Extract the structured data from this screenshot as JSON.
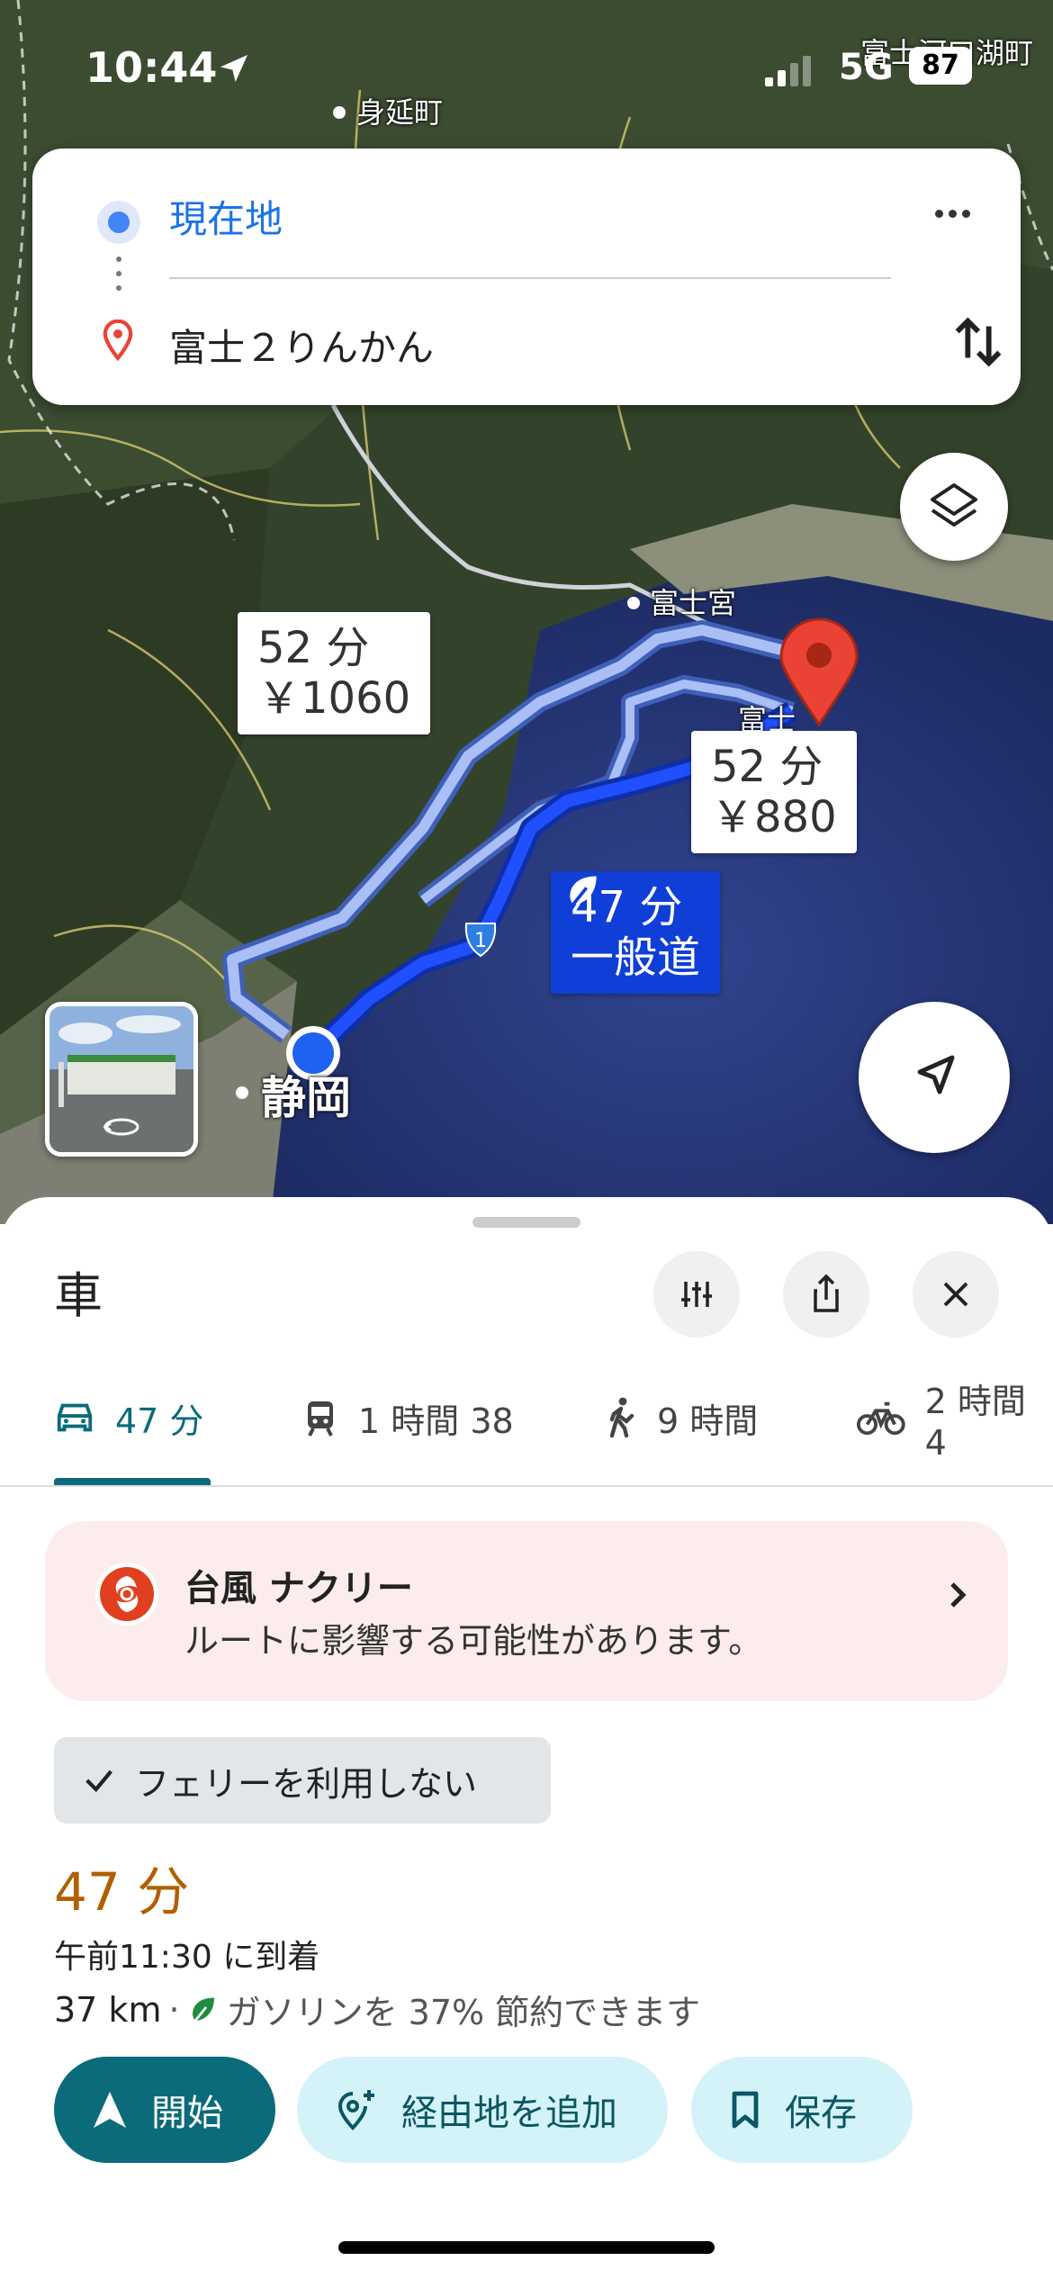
{
  "status_bar": {
    "time": "10:44",
    "network": "5G",
    "battery": "87"
  },
  "map": {
    "place_labels": {
      "minobu": "身延町",
      "fujinomiya": "富士宮",
      "fujikawaguchiko": "富士河口湖町",
      "shizuoka": "静岡",
      "fuji_partial": "富士"
    },
    "route_badges": {
      "alt1": {
        "time": "52 分",
        "price": "￥1060"
      },
      "alt2": {
        "time": "52 分",
        "price": "￥880"
      },
      "selected": {
        "time": "47 分",
        "road": "一般道"
      }
    },
    "highway_number": "1"
  },
  "search": {
    "origin": "現在地",
    "destination": "富士２りんかん"
  },
  "sheet": {
    "mode_title": "車",
    "tabs": [
      {
        "label": "47 分",
        "icon": "car-icon",
        "active": true
      },
      {
        "label": "1 時間 38",
        "icon": "train-icon",
        "active": false
      },
      {
        "label": "9 時間",
        "icon": "walk-icon",
        "active": false
      },
      {
        "label": "2 時間 4",
        "icon": "bike-icon",
        "active": false
      }
    ],
    "alert": {
      "title": "台風 ナクリー",
      "subtitle": "ルートに影響する可能性があります。"
    },
    "filter_chip": "フェリーを利用しない",
    "route": {
      "duration": "47 分",
      "arrival": "午前11:30 に到着",
      "distance": "37 km",
      "separator": "·",
      "eco_note": "ガソリンを 37% 節約できます"
    },
    "buttons": {
      "start": "開始",
      "add_stop": "経由地を追加",
      "save": "保存"
    }
  },
  "colors": {
    "accent": "#0b6b7a",
    "duration": "#b06000",
    "route_selected": "#1a3fe0",
    "alert_bg": "#fdecec"
  }
}
